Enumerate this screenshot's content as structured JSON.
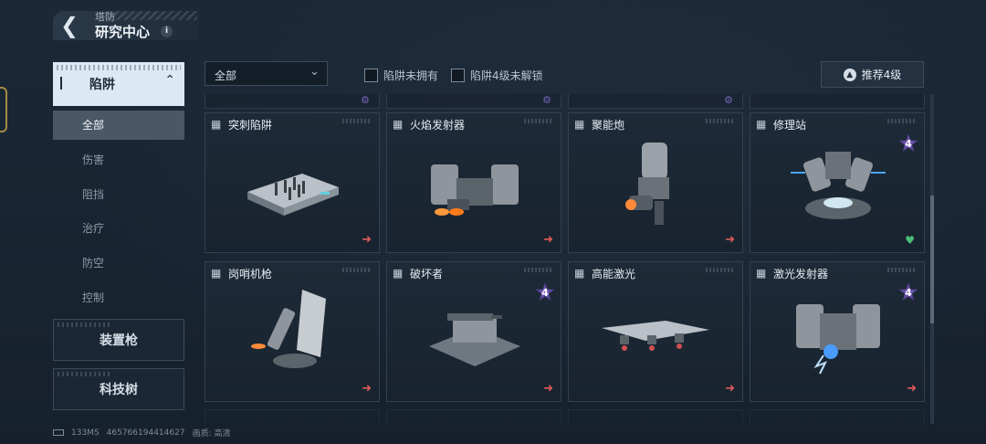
{
  "header": {
    "breadcrumb": "塔防",
    "title": "研究中心",
    "info": "i"
  },
  "nav": {
    "active_category": "陷阱",
    "sub_items": [
      "全部",
      "伤害",
      "阻挡",
      "治疗",
      "防空",
      "控制"
    ],
    "categories": [
      "装置枪",
      "科技树"
    ]
  },
  "filters": {
    "dropdown_value": "全部",
    "check_unowned": "陷阱未拥有",
    "check_lv4": "陷阱4级未解锁",
    "recommend": "推荐4级"
  },
  "cards": [
    {
      "name": "突刺陷阱",
      "badge": ""
    },
    {
      "name": "火焰发射器",
      "badge": ""
    },
    {
      "name": "聚能炮",
      "badge": ""
    },
    {
      "name": "修理站",
      "badge": "4"
    },
    {
      "name": "岗哨机枪",
      "badge": ""
    },
    {
      "name": "破坏者",
      "badge": "4"
    },
    {
      "name": "高能激光",
      "badge": ""
    },
    {
      "name": "激光发射器",
      "badge": "4"
    }
  ],
  "status": {
    "ping": "133MS",
    "id": "465766194414627",
    "quality": "画质: 高清"
  },
  "colors": {
    "active_tab_bg": "#dde9f2",
    "badge": "#6a52b0",
    "arrow": "#e05a5a",
    "heart": "#4cc07a"
  }
}
